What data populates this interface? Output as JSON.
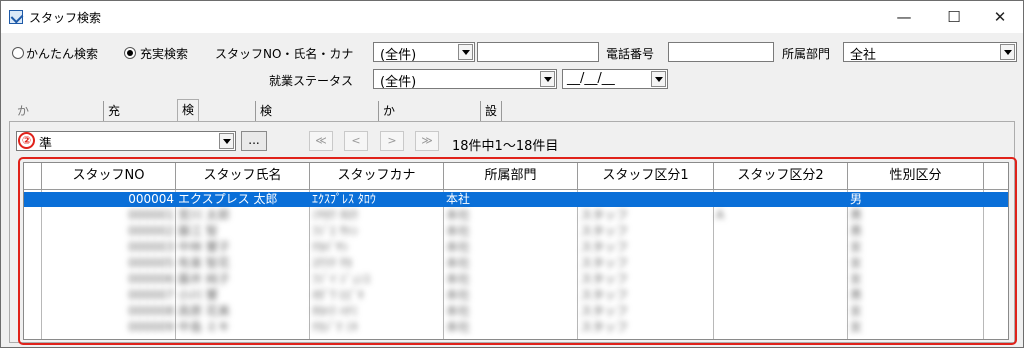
{
  "window": {
    "title": "スタッフ検索",
    "minimize": "—",
    "maximize": "☐",
    "close": "✕"
  },
  "search": {
    "mode_simple": "かんたん検索",
    "mode_full": "充実検索",
    "staff_label": "スタッフNO・氏名・カナ",
    "staff_combo_value": "(全件)",
    "staff_input_value": "",
    "phone_label": "電話番号",
    "phone_value": "",
    "dept_label": "所属部門",
    "dept_value": "全社",
    "status_label": "就業ステータス",
    "status_value": "(全件)",
    "date_value": "__/__/__"
  },
  "tabs": [
    {
      "label": "かんたん検索"
    },
    {
      "label": "充実検索"
    },
    {
      "label": "検索結果"
    },
    {
      "label": "検索結果(顔写真)"
    },
    {
      "label": "かんたん確認"
    },
    {
      "label": "設定"
    }
  ],
  "results": {
    "preset_value": "準",
    "more_label": "...",
    "nav": [
      "≪",
      "<",
      ">",
      "≫"
    ],
    "count_text": "18件中1〜18件目",
    "callout": "②"
  },
  "table": {
    "columns": [
      "スタッフNO",
      "スタッフ氏名",
      "スタッフカナ",
      "所属部門",
      "スタッフ区分1",
      "スタッフ区分2",
      "性別区分"
    ],
    "rows": [
      [
        "000004",
        "エクスプレス 太郎",
        "ｴｸｽﾌﾟﾚｽ ﾀﾛｳ",
        "本社",
        "",
        "",
        "男"
      ],
      [
        "000001",
        "宮川 太郎",
        "ﾐﾔｶﾜ ﾀﾛｳ",
        "本社",
        "スタッフ",
        "A",
        "男"
      ],
      [
        "000002",
        "藤江 智",
        "ﾌｼﾞｴ ｻﾄｼ",
        "本社",
        "スタッフ",
        "",
        "男"
      ],
      [
        "000003",
        "中林 響子",
        "ﾅｶﾊﾞﾔｼ",
        "本社",
        "スタッフ",
        "",
        "女"
      ],
      [
        "000005",
        "有楽 智花",
        "ﾕｳﾗｸ ﾁｶ",
        "本社",
        "スタッフ",
        "",
        "女"
      ],
      [
        "000006",
        "藤井 純子",
        "ﾌｼﾞｲ ｼﾞｭﾝｺ",
        "本社",
        "スタッフ",
        "",
        "女"
      ],
      [
        "000007",
        "小川 響",
        "ｵｶﾞﾜ ﾋﾋﾞｷ",
        "本社",
        "スタッフ",
        "",
        "男"
      ],
      [
        "000008",
        "高原 花美",
        "ﾀｶﾊﾗ ﾊﾅﾐ",
        "本社",
        "スタッフ",
        "",
        "女"
      ],
      [
        "000009",
        "中島 ミキ",
        "ﾅｶｼﾞﾏ ﾐｷ",
        "本社",
        "スタッフ",
        "",
        "女"
      ]
    ]
  }
}
